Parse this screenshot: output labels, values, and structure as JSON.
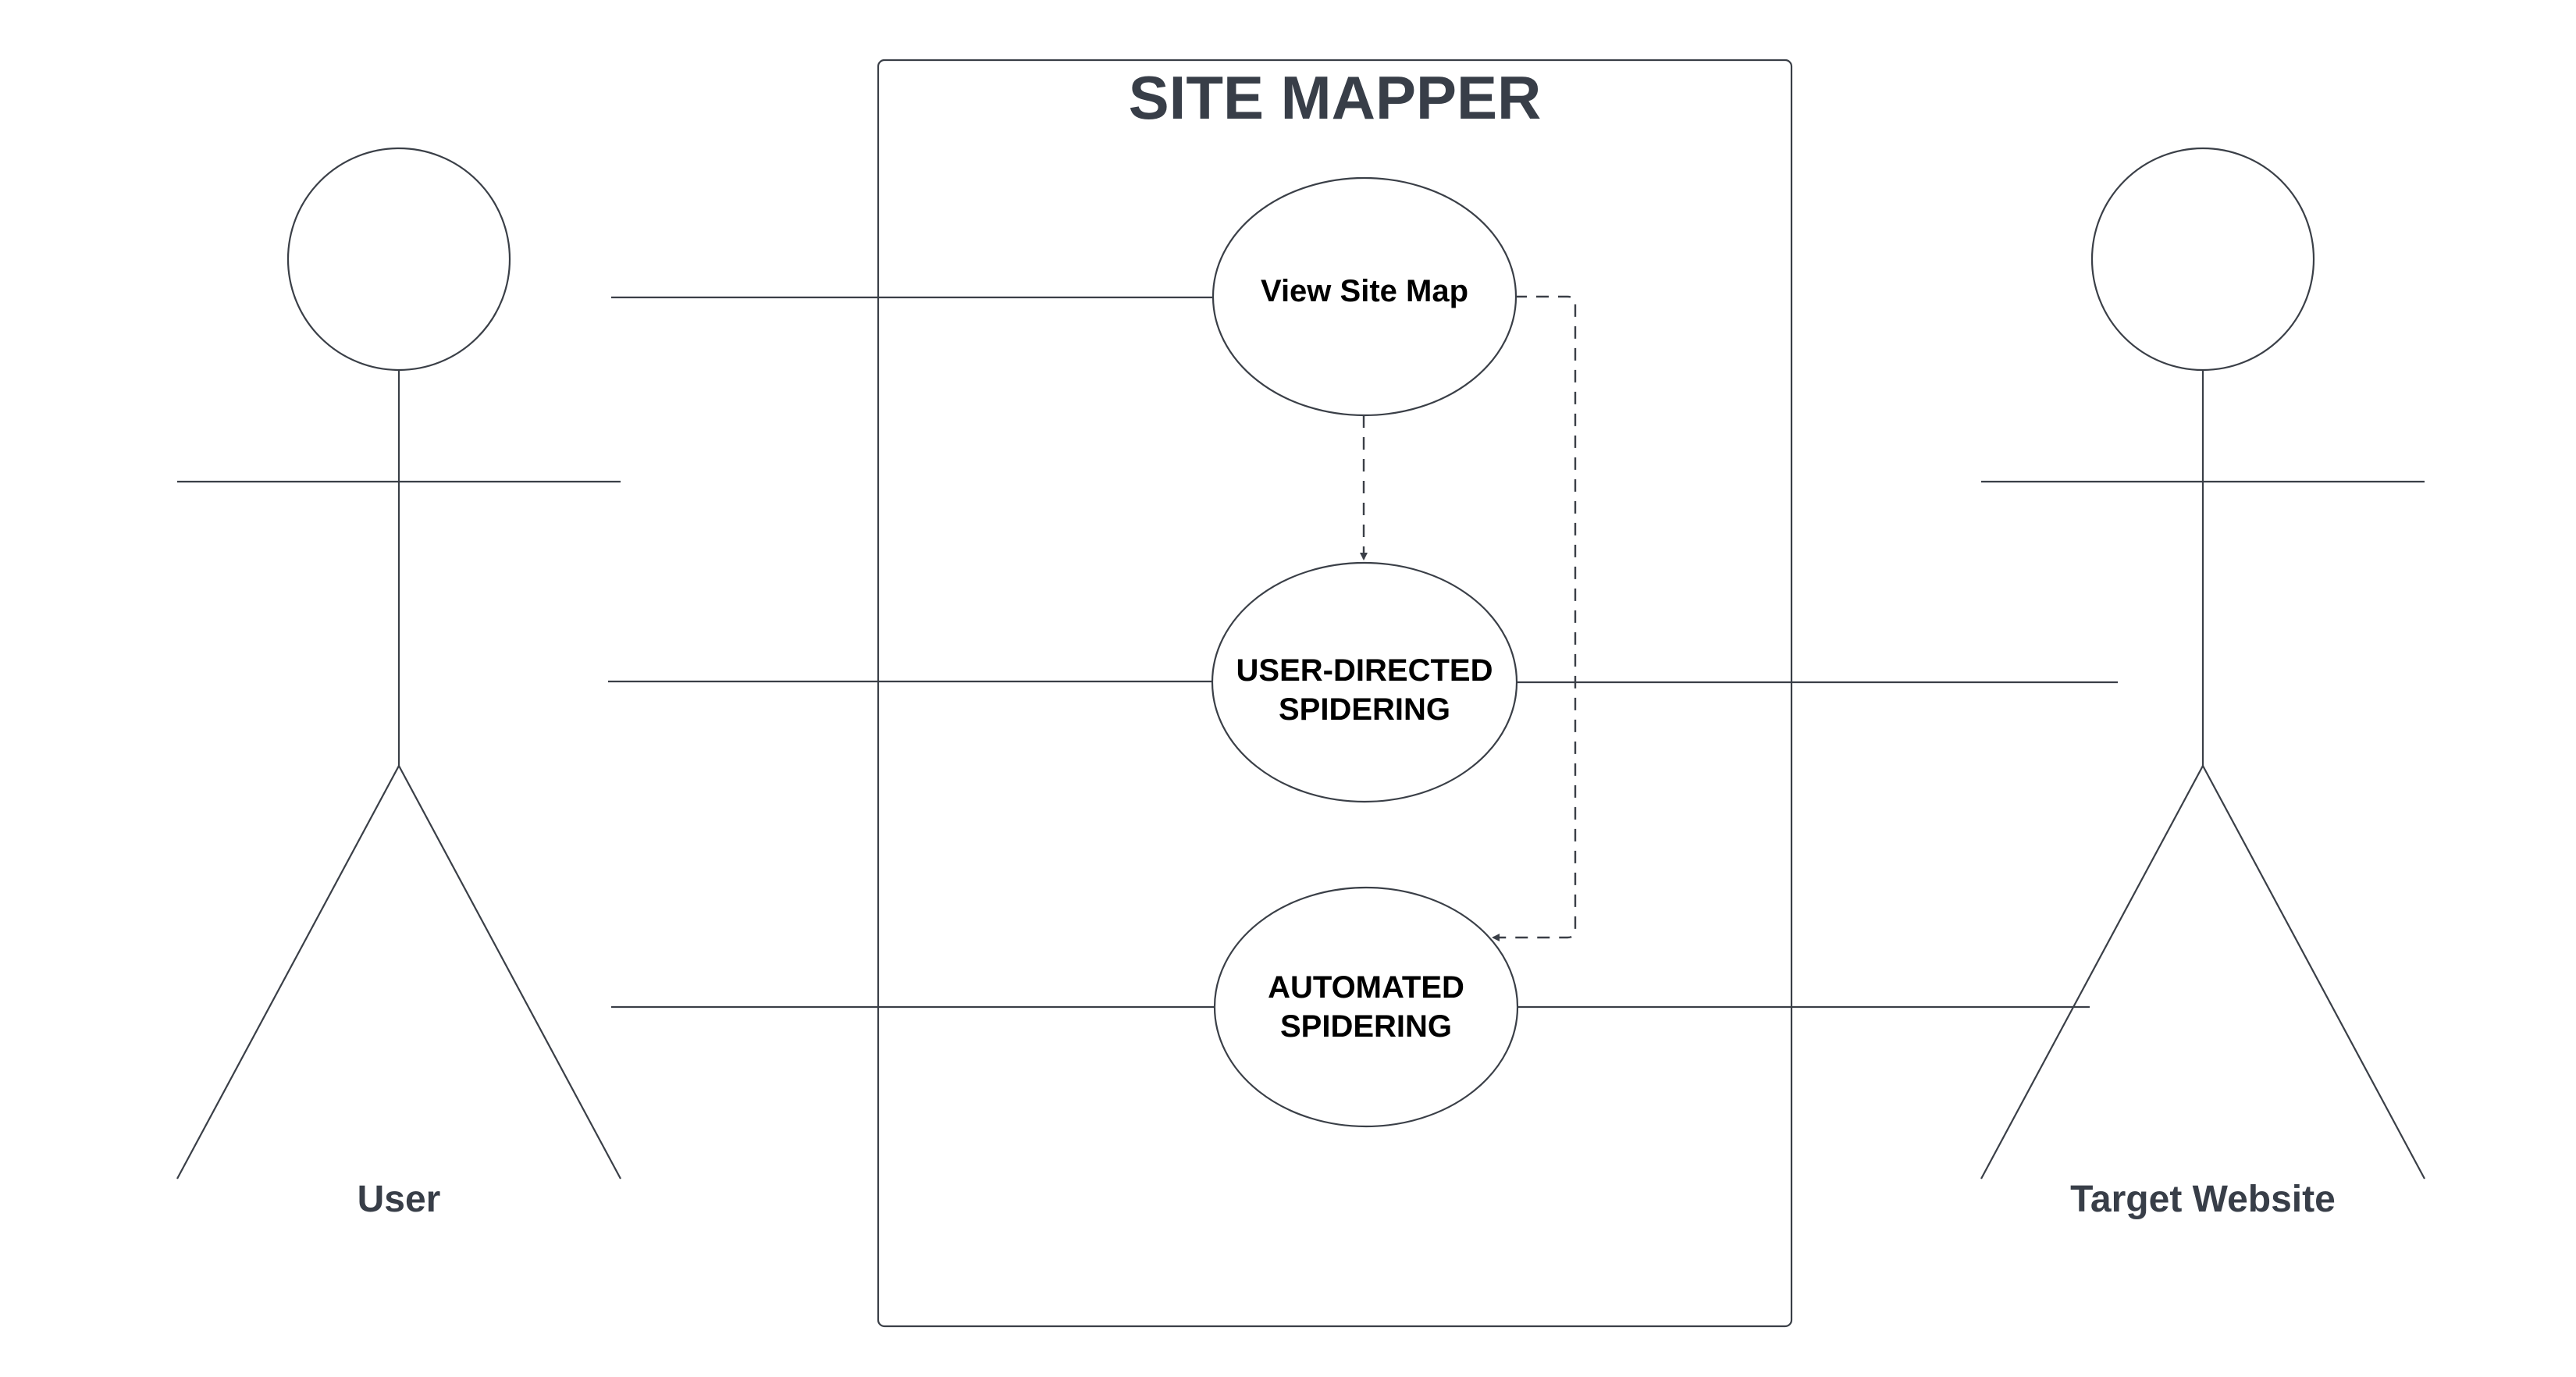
{
  "system": {
    "title": "SITE MAPPER"
  },
  "actors": {
    "user": {
      "label": "User"
    },
    "target": {
      "label": "Target Website"
    }
  },
  "use_cases": {
    "view_site_map": {
      "line1": "View Site Map"
    },
    "user_directed": {
      "line1": "USER-DIRECTED",
      "line2": "SPIDERING"
    },
    "automated": {
      "line1": "AUTOMATED",
      "line2": "SPIDERING"
    }
  },
  "colors": {
    "stroke": "#3a3f47",
    "heading_text": "#383e48",
    "use_case_text": "#000000",
    "background": "#ffffff"
  }
}
